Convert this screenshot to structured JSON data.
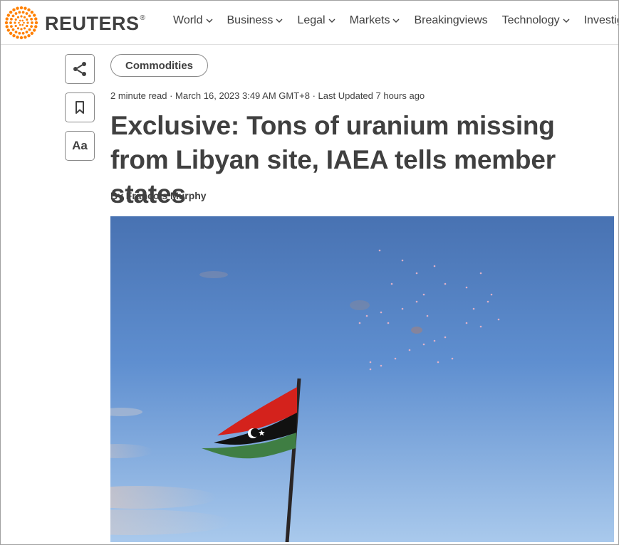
{
  "brand": {
    "name": "REUTERS",
    "registered": "®",
    "logo_color": "#ff8000"
  },
  "nav": {
    "items": [
      {
        "label": "World",
        "has_dropdown": true
      },
      {
        "label": "Business",
        "has_dropdown": true
      },
      {
        "label": "Legal",
        "has_dropdown": true
      },
      {
        "label": "Markets",
        "has_dropdown": true
      },
      {
        "label": "Breakingviews",
        "has_dropdown": false
      },
      {
        "label": "Technology",
        "has_dropdown": true
      },
      {
        "label": "Investiga",
        "has_dropdown": false
      }
    ]
  },
  "sidebar": {
    "actions": [
      {
        "name": "share",
        "icon": "share-icon"
      },
      {
        "name": "bookmark",
        "icon": "bookmark-icon"
      },
      {
        "name": "font-size",
        "label": "Aa"
      }
    ]
  },
  "article": {
    "tag": "Commodities",
    "meta": "2 minute read · March 16, 2023 3:49 AM GMT+8 · Last Updated 7 hours ago",
    "headline": "Exclusive: Tons of uranium missing from Libyan site, IAEA tells member states",
    "byline_prefix": "By ",
    "author": "Francois Murphy",
    "image": {
      "subject": "Libyan flag on a pole against blue sky with fireworks"
    }
  },
  "colors": {
    "text": "#404040",
    "accent": "#ff8000",
    "sky_top": "#4a78b8",
    "sky_bottom": "#a8c8ec"
  }
}
